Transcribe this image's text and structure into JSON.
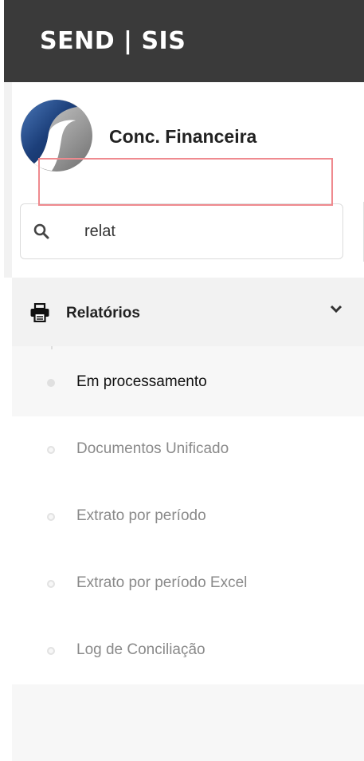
{
  "header": {
    "title": "SEND | SIS"
  },
  "brand": {
    "company_name": "Conc. Financeira"
  },
  "search": {
    "value": "relat",
    "icon": "search-icon"
  },
  "menu": {
    "section_label": "Relatórios",
    "section_icon": "printer-icon",
    "expanded": true,
    "items": [
      {
        "label": "Em processamento",
        "active": true
      },
      {
        "label": "Documentos Unificado",
        "active": false,
        "highlighted": true
      },
      {
        "label": "Extrato por período",
        "active": false
      },
      {
        "label": "Extrato por período Excel",
        "active": false
      },
      {
        "label": "Log de Conciliação",
        "active": false
      }
    ]
  },
  "colors": {
    "header_bg": "#3a3a3a",
    "logo_blue": "#1c3f7a",
    "highlight_border": "#ef8a8f"
  }
}
